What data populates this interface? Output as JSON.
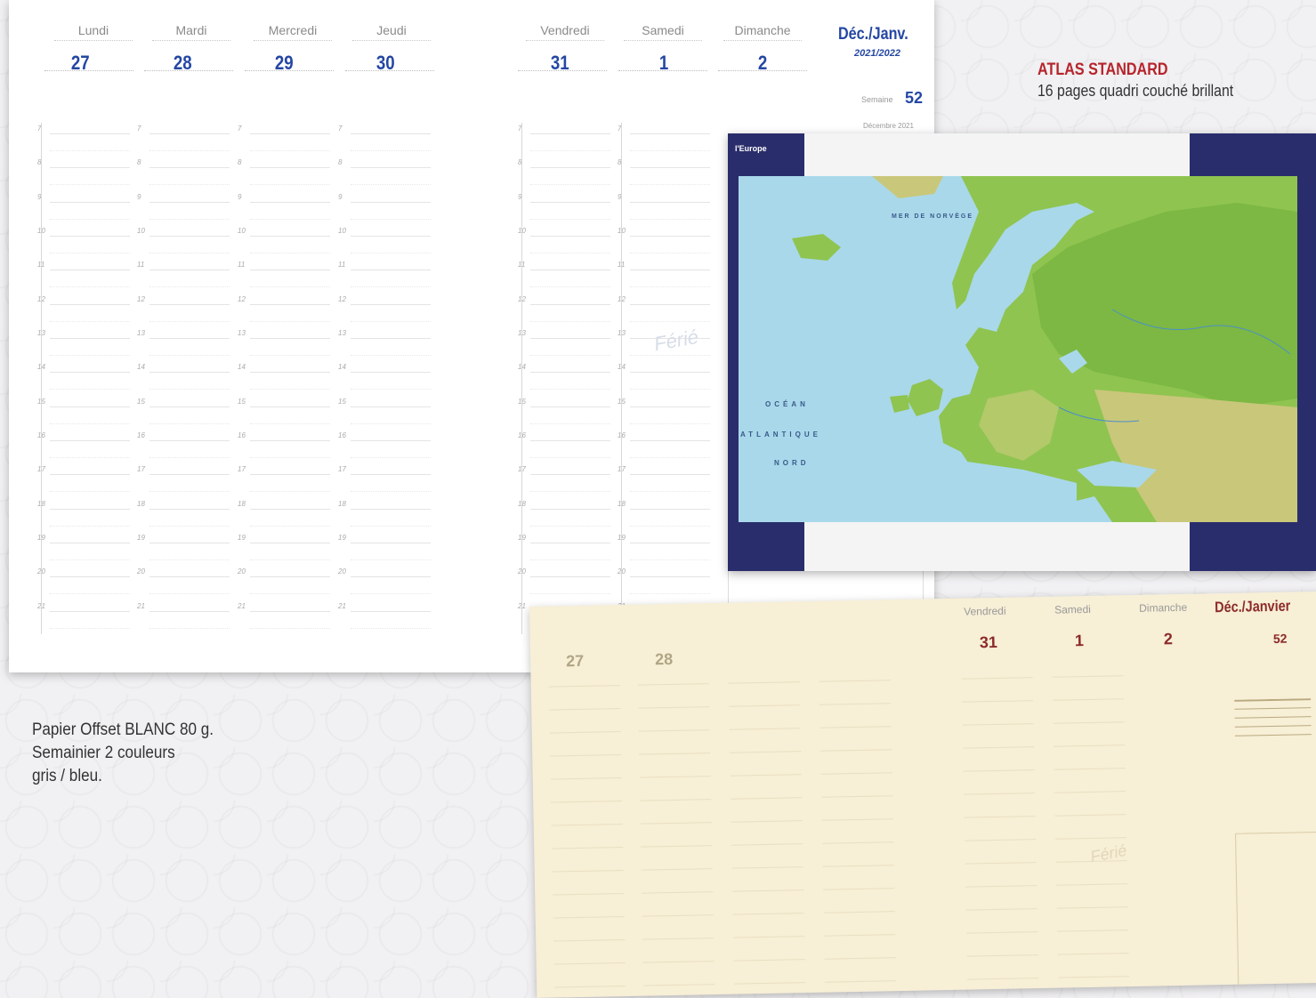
{
  "planner": {
    "days": [
      {
        "name": "Lundi",
        "num": "27"
      },
      {
        "name": "Mardi",
        "num": "28"
      },
      {
        "name": "Mercredi",
        "num": "29"
      },
      {
        "name": "Jeudi",
        "num": "30"
      },
      {
        "name": "Vendredi",
        "num": "31"
      },
      {
        "name": "Samedi",
        "num": "1"
      },
      {
        "name": "Dimanche",
        "num": "2"
      }
    ],
    "month_title": "Déc./Janv.",
    "year": "2021/2022",
    "week_label": "Semaine",
    "week_number": "52",
    "month_small": "Décembre 2021",
    "ferie": "Férié",
    "hours": [
      "7",
      "8",
      "9",
      "10",
      "11",
      "12",
      "13",
      "14",
      "15",
      "16",
      "17",
      "18",
      "19",
      "20",
      "21"
    ]
  },
  "map": {
    "tab": "l'Europe",
    "ocean_lines": [
      "OCÉAN",
      "ATLANTIQUE",
      "NORD"
    ],
    "sea_label": "MER DE NORVÈGE"
  },
  "atlas": {
    "title": "ATLAS STANDARD",
    "subtitle": "16 pages quadri couché brillant"
  },
  "paper_note": {
    "line1": "Papier Offset BLANC 80 g.",
    "line2": "Semainier 2 couleurs",
    "line3": "gris / bleu."
  },
  "cream": {
    "month_title": "Déc./Janvier",
    "week_number": "52",
    "ferie": "Férié",
    "days": [
      {
        "name": "Vendredi",
        "num": "31"
      },
      {
        "name": "Samedi",
        "num": "1"
      },
      {
        "name": "Dimanche",
        "num": "2"
      }
    ],
    "partial_nums": [
      "27",
      "28"
    ]
  },
  "colors": {
    "blue_accent": "#2447a3",
    "red_accent": "#b6242b",
    "navy_band": "#2a2d6b",
    "cream_paper": "#f7efd6"
  }
}
